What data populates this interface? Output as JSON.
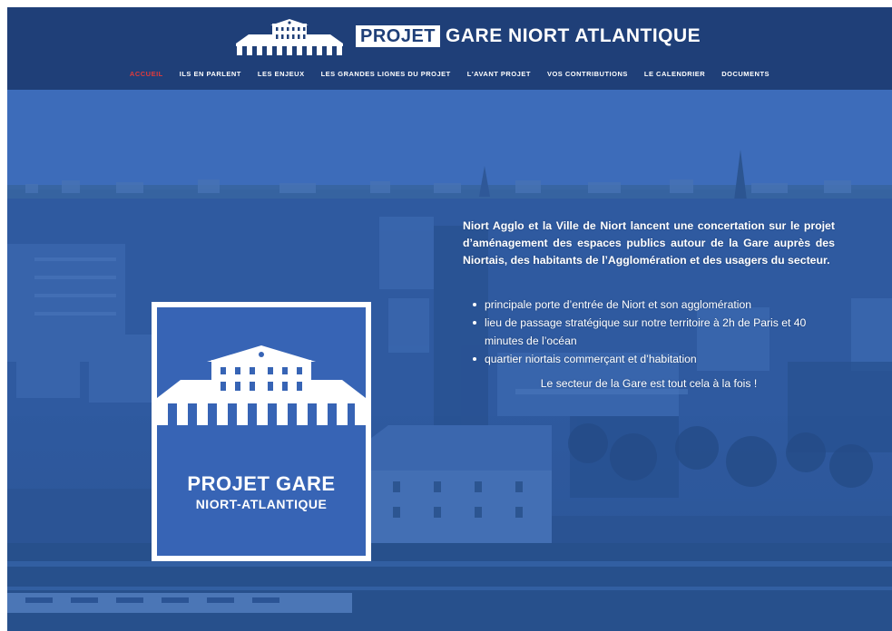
{
  "brand": {
    "logo_icon": "station-building-icon",
    "highlight": "PROJET",
    "rest": "GARE NIORT ATLANTIQUE"
  },
  "nav": {
    "items": [
      {
        "label": "ACCUEIL",
        "active": true
      },
      {
        "label": "ILS EN PARLENT",
        "active": false
      },
      {
        "label": "LES ENJEUX",
        "active": false
      },
      {
        "label": "LES GRANDES LIGNES DU PROJET",
        "active": false
      },
      {
        "label": "L'AVANT PROJET",
        "active": false
      },
      {
        "label": "VOS CONTRIBUTIONS",
        "active": false
      },
      {
        "label": "LE CALENDRIER",
        "active": false
      },
      {
        "label": "DOCUMENTS",
        "active": false
      }
    ]
  },
  "logo_card": {
    "icon": "station-building-icon",
    "title": "PROJET GARE",
    "subtitle": "NIORT-ATLANTIQUE"
  },
  "content": {
    "intro": "Niort Agglo et la Ville de Niort lancent une concertation sur le projet d’aménagement des espaces publics autour de la Gare auprès des Niortais, des habitants de l’Agglomération et des usagers du secteur.",
    "bullets": [
      "principale porte d’entrée de Niort et son agglomération",
      "lieu de passage stratégique sur notre territoire à 2h de Paris et 40 minutes de l’océan",
      "quartier niortais commerçant et d’habitation"
    ],
    "closing": "Le secteur de la Gare est tout cela à la fois !"
  },
  "colors": {
    "header_bg": "#1f3f78",
    "hero_overlay": "#2f5aa0",
    "logo_blue": "#3764b5",
    "nav_active": "#e23b3b",
    "text": "#ffffff"
  }
}
